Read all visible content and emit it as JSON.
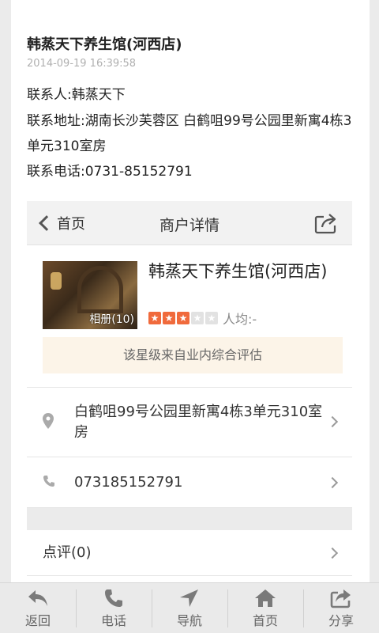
{
  "post": {
    "title": "韩蒸天下养生馆(河西店)",
    "timestamp": "2014-09-19 16:39:58",
    "contact": "联系人:韩蒸天下",
    "address": "联系地址:湖南长沙芙蓉区 白鹤咀99号公园里新寓4栋3单元310室房",
    "phone": "联系电话:0731-85152791"
  },
  "merchant_nav": {
    "back_label": "首页",
    "title": "商户详情"
  },
  "shop": {
    "name": "韩蒸天下养生馆(河西店)",
    "album_label": "相册(10)",
    "rating_stars": 3,
    "rating_max": 5,
    "avg_label": "人均:-",
    "rating_note": "该星级来自业内综合评估",
    "address": "白鹤咀99号公园里新寓4栋3单元310室房",
    "phone": "073185152791",
    "reviews_label": "点评(0)"
  },
  "tabbar": [
    {
      "label": "返回",
      "icon": "back-icon"
    },
    {
      "label": "电话",
      "icon": "phone-icon"
    },
    {
      "label": "导航",
      "icon": "navigate-icon"
    },
    {
      "label": "首页",
      "icon": "home-icon"
    },
    {
      "label": "分享",
      "icon": "share-icon"
    }
  ],
  "colors": {
    "star_on": "#f06a3c",
    "star_off": "#e2e2e2",
    "note_bg": "#fcf4e8"
  }
}
